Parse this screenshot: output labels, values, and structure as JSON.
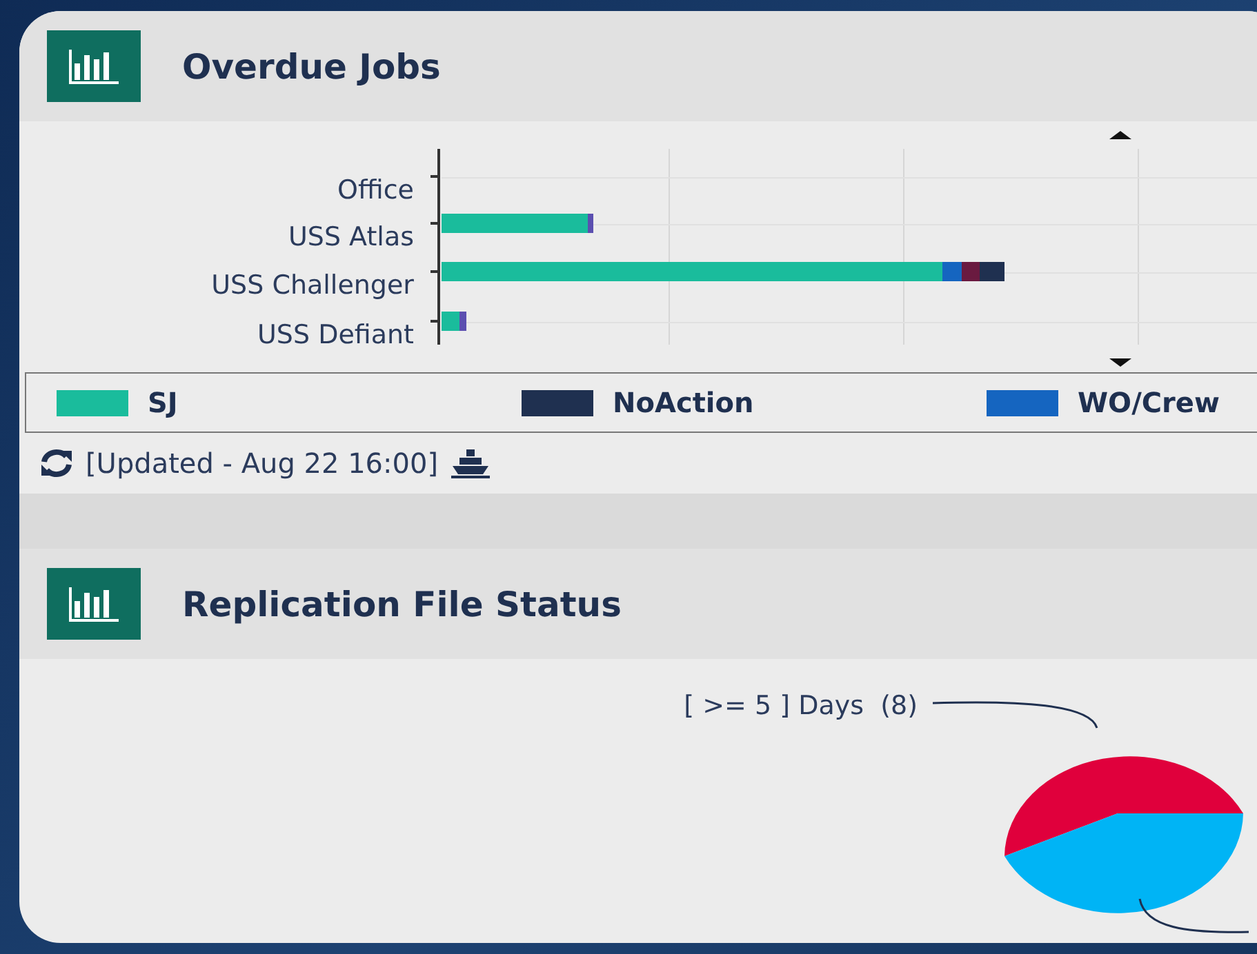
{
  "overdue_jobs": {
    "title": "Overdue Jobs",
    "chart": {
      "categories": [
        "Office",
        "USS Atlas",
        "USS Challenger",
        "USS Defiant"
      ]
    },
    "legend": [
      {
        "label": "SJ",
        "color": "#1abc9c"
      },
      {
        "label": "NoAction",
        "color": "#1f3050"
      },
      {
        "label": "WO/Crew",
        "color": "#1565c0"
      }
    ],
    "status": "[Updated - Aug 22 16:00]"
  },
  "replication_file_status": {
    "title": "Replication File Status",
    "pie_label": "[ >= 5 ] Days  (8)"
  }
}
